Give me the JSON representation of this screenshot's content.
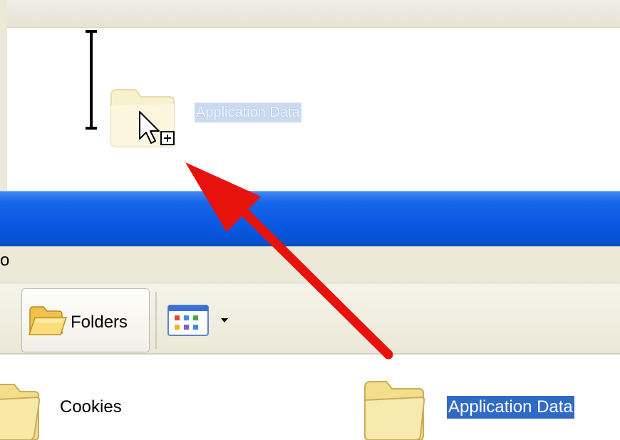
{
  "drag_ghost": {
    "label": "Application Data",
    "icon": "folder-icon",
    "cursor": "copy-cursor-icon"
  },
  "window": {
    "menu_fragment": "o",
    "toolbar": {
      "folders_label": "Folders",
      "views_icon": "views-icon"
    },
    "files": [
      {
        "label": "Cookies",
        "icon": "folder-icon"
      },
      {
        "label": "Application Data",
        "icon": "folder-icon",
        "selected": true
      }
    ]
  },
  "colors": {
    "title_bar": "#0a5ae6",
    "selection": "#316ac5",
    "annotation_arrow": "#e8120c",
    "folder": "#f6e9a8"
  }
}
